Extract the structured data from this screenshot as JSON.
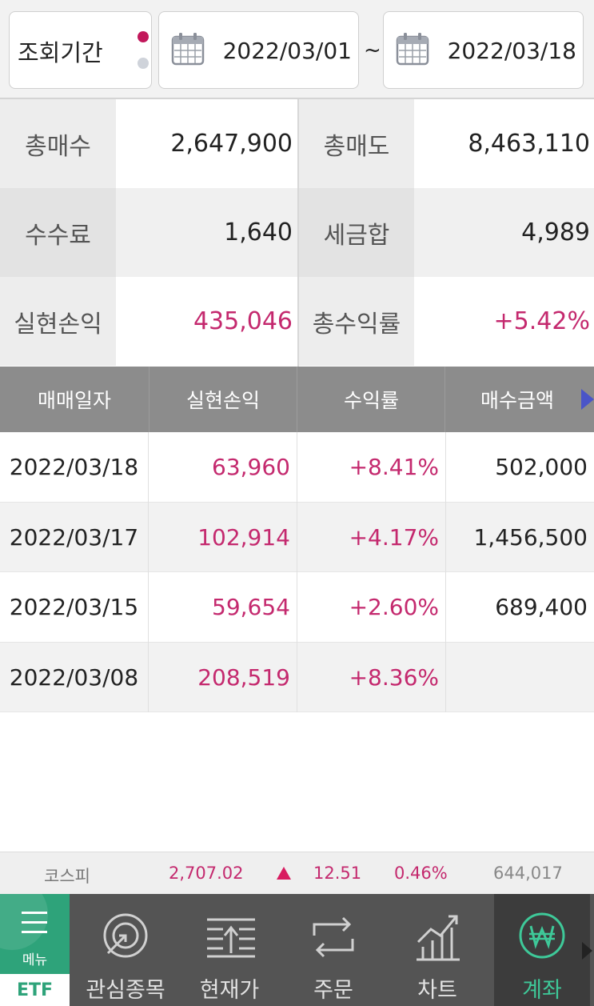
{
  "period": {
    "label": "조회기간",
    "start_date": "2022/03/01",
    "separator": "~",
    "end_date": "2022/03/18",
    "icons": [
      "calendar-icon",
      "calendar-icon"
    ]
  },
  "summary": {
    "total_buy_label": "총매수",
    "total_buy": "2,647,900",
    "total_sell_label": "총매도",
    "total_sell": "8,463,110",
    "fee_label": "수수료",
    "fee": "1,640",
    "tax_label": "세금합",
    "tax": "4,989",
    "realized_label": "실현손익",
    "realized": "435,046",
    "return_label": "총수익률",
    "return": "+5.42%"
  },
  "table": {
    "headers": [
      "매매일자",
      "실현손익",
      "수익률",
      "매수금액"
    ],
    "rows": [
      {
        "date": "2022/03/18",
        "pnl": "63,960",
        "rate": "+8.41%",
        "buy": "502,000"
      },
      {
        "date": "2022/03/17",
        "pnl": "102,914",
        "rate": "+4.17%",
        "buy": "1,456,500"
      },
      {
        "date": "2022/03/15",
        "pnl": "59,654",
        "rate": "+2.60%",
        "buy": "689,400"
      },
      {
        "date": "2022/03/08",
        "pnl": "208,519",
        "rate": "+8.36%",
        "buy": ""
      }
    ]
  },
  "ticker": {
    "name": "코스피",
    "index": "2,707.02",
    "change": "12.51",
    "percent": "0.46%",
    "volume": "644,017"
  },
  "nav": {
    "menu": "메뉴",
    "etf": "ETF",
    "items": [
      "관심종목",
      "현재가",
      "주문",
      "차트",
      "계좌"
    ],
    "active": "계좌"
  },
  "colors": {
    "accent_pink": "#c4296e",
    "accent_green": "#2ea37a",
    "header_gray": "#8c8c8c",
    "nav_bg": "#545454"
  }
}
